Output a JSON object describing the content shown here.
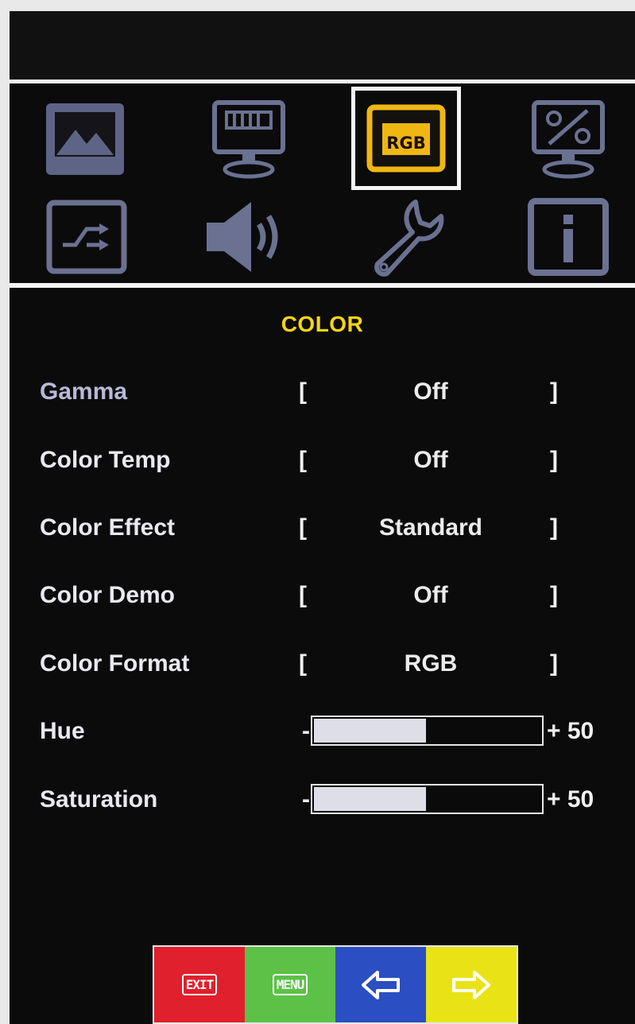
{
  "menu": {
    "title": "COLOR",
    "selected_tab_label": "RGB",
    "tabs": [
      {
        "name": "picture",
        "icon": "landscape-picture-icon"
      },
      {
        "name": "display",
        "icon": "monitor-display-icon"
      },
      {
        "name": "color",
        "icon": "rgb-icon",
        "label": "RGB"
      },
      {
        "name": "advanced",
        "icon": "monitor-adjust-icon"
      },
      {
        "name": "input",
        "icon": "input-switch-icon"
      },
      {
        "name": "audio",
        "icon": "speaker-icon"
      },
      {
        "name": "setup",
        "icon": "wrench-icon"
      },
      {
        "name": "information",
        "icon": "info-icon"
      }
    ],
    "bracket_open": "[",
    "bracket_close": "]",
    "minus": "-",
    "settings": [
      {
        "label": "Gamma",
        "value": "Off"
      },
      {
        "label": "Color Temp",
        "value": "Off"
      },
      {
        "label": "Color Effect",
        "value": "Standard"
      },
      {
        "label": "Color Demo",
        "value": "Off"
      },
      {
        "label": "Color Format",
        "value": "RGB"
      }
    ],
    "sliders": [
      {
        "label": "Hue",
        "value": 50,
        "display": "+ 50"
      },
      {
        "label": "Saturation",
        "value": 50,
        "display": "+ 50"
      }
    ]
  },
  "buttons": {
    "exit": "EXIT",
    "menu": "MENU",
    "left": "left-arrow-icon",
    "right": "right-arrow-icon"
  },
  "colors": {
    "title": "#f5d612",
    "selected_icon": "#f0b713",
    "inactive_icon": "#6b7191",
    "exit": "#e0202c",
    "menu": "#5cc147",
    "left": "#2b4fc2",
    "right": "#e9e316"
  }
}
